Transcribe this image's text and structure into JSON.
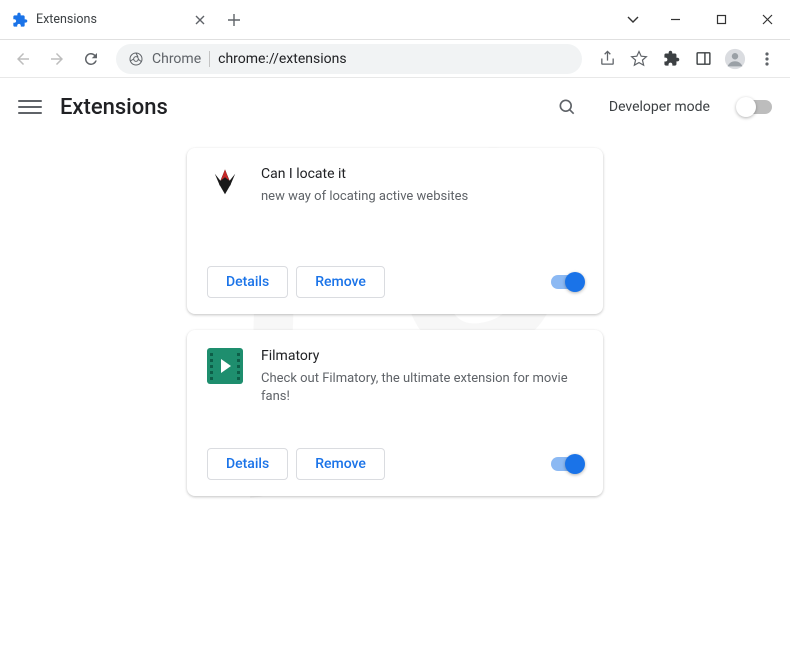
{
  "tab": {
    "title": "Extensions"
  },
  "omnibox": {
    "label": "Chrome",
    "url": "chrome://extensions"
  },
  "appbar": {
    "title": "Extensions",
    "devmode_label": "Developer mode"
  },
  "buttons": {
    "details": "Details",
    "remove": "Remove"
  },
  "extensions": [
    {
      "name": "Can I locate it",
      "description": "new way of locating active websites",
      "enabled": true
    },
    {
      "name": "Filmatory",
      "description": "Check out Filmatory, the ultimate extension for movie fans!",
      "enabled": true
    }
  ]
}
